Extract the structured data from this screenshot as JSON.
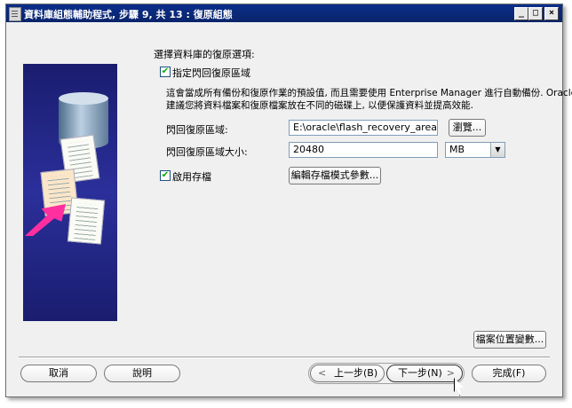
{
  "window": {
    "title": "資料庫組態輔助程式, 步驟 9, 共 13 : 復原組態",
    "min_label": "_",
    "max_label": "□",
    "close_label": "×"
  },
  "main": {
    "heading": "選擇資料庫的復原選項:",
    "flash_recovery": {
      "checkbox_label": "指定閃回復原區域",
      "checked_mark": "✔",
      "description_line1": "這會當成所有備份和復原作業的預設值, 而且需要使用 Enterprise Manager 進行自動備份. Oracle",
      "description_line2": "建議您將資料檔案和復原檔案放在不同的磁碟上, 以便保護資料並提高效能.",
      "area_label": "閃回復原區域:",
      "area_value": "E:\\oracle\\flash_recovery_area",
      "browse_label": "瀏覽...",
      "size_label": "閃回復原區域大小:",
      "size_value": "20480",
      "size_unit": "MB"
    },
    "archiving": {
      "checkbox_label": "啟用存檔",
      "checked_mark": "✔",
      "edit_params_label": "編輯存檔模式參數..."
    },
    "file_location_vars_label": "檔案位置變數..."
  },
  "footer": {
    "cancel_label": "取消",
    "help_label": "說明",
    "back_label": "上一步(B)",
    "back_arrow": "<",
    "next_label": "下一步(N)",
    "next_arrow": ">",
    "finish_label": "完成(F)"
  },
  "colors": {
    "titlebar": "#0a246a",
    "illustration_bg": "#2b2f9a",
    "arrow": "#ff2fa0"
  }
}
